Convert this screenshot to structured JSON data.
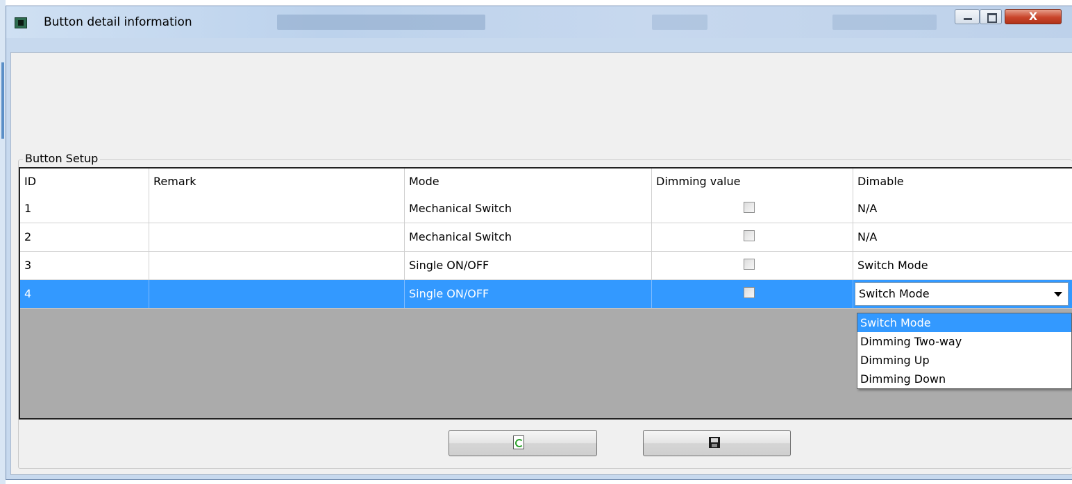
{
  "window": {
    "title": "Button detail information"
  },
  "titlebar": {
    "close_label": "X"
  },
  "group": {
    "legend": "Button Setup"
  },
  "table": {
    "columns": [
      "ID",
      "Remark",
      "Mode",
      "Dimming value",
      "Dimable"
    ],
    "rows": [
      {
        "id": "1",
        "remark": "",
        "mode": "Mechanical Switch",
        "dimming_value_checked": false,
        "dimable": "N/A"
      },
      {
        "id": "2",
        "remark": "",
        "mode": "Mechanical Switch",
        "dimming_value_checked": false,
        "dimable": "N/A"
      },
      {
        "id": "3",
        "remark": "",
        "mode": "Single ON/OFF",
        "dimming_value_checked": false,
        "dimable": "Switch Mode"
      },
      {
        "id": "4",
        "remark": "",
        "mode": "Single ON/OFF",
        "dimming_value_checked": false,
        "dimable": "Switch Mode",
        "selected": true
      }
    ]
  },
  "dropdown": {
    "value": "Switch Mode",
    "options": [
      "Switch Mode",
      "Dimming Two-way",
      "Dimming Up",
      "Dimming Down"
    ],
    "highlighted": "Switch Mode"
  },
  "buttons": {
    "refresh_icon": "refresh-icon",
    "save_icon": "save-icon"
  },
  "colors": {
    "selection": "#3399ff",
    "grid_background": "#ababab"
  }
}
